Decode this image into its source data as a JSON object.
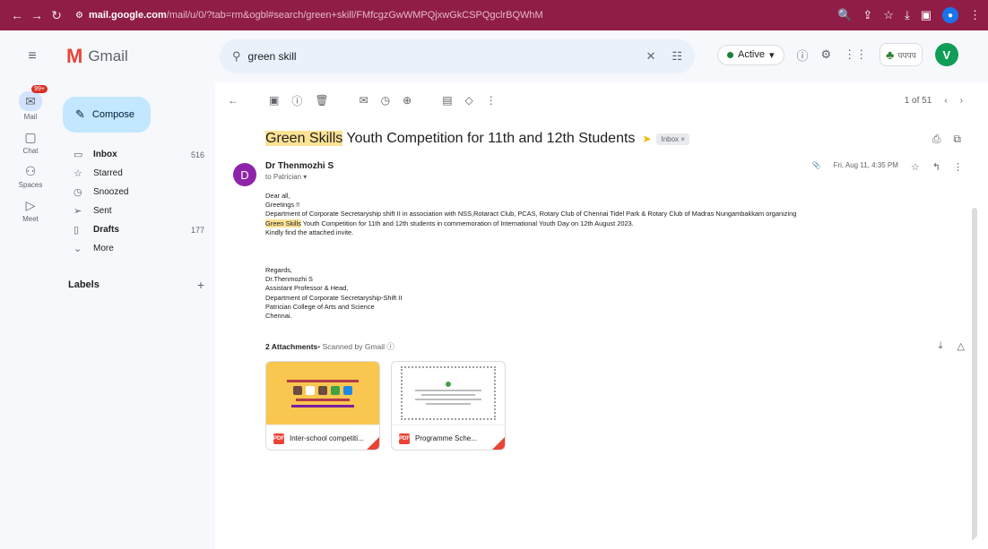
{
  "browser": {
    "url_host": "mail.google.com",
    "url_path": "/mail/u/0/?tab=rm&ogbl#search/green+skill/FMfcgzGwWMPQjxwGkCSPQgclrBQWhM"
  },
  "app": {
    "name": "Gmail"
  },
  "search": {
    "query": "green skill"
  },
  "header": {
    "status": "Active",
    "org_logo_text": "पपपप",
    "avatar_letter": "V"
  },
  "rail": {
    "items": [
      {
        "label": "Mail",
        "badge": "99+"
      },
      {
        "label": "Chat"
      },
      {
        "label": "Spaces"
      },
      {
        "label": "Meet"
      }
    ]
  },
  "sidebar": {
    "compose": "Compose",
    "folders": [
      {
        "label": "Inbox",
        "count": "516",
        "bold": true
      },
      {
        "label": "Starred",
        "count": ""
      },
      {
        "label": "Snoozed",
        "count": ""
      },
      {
        "label": "Sent",
        "count": ""
      },
      {
        "label": "Drafts",
        "count": "177",
        "bold": true
      },
      {
        "label": "More",
        "count": ""
      }
    ],
    "labels_title": "Labels"
  },
  "toolbar": {
    "pager": "1 of 51"
  },
  "email": {
    "subject_hl": "Green Skills",
    "subject_rest": " Youth Competition for 11th and 12th Students",
    "label_chip": "Inbox ×",
    "sender_initial": "D",
    "sender_name": "Dr Thenmozhi S",
    "to": "to Patrician ▾",
    "date": "Fri, Aug 11, 4:35 PM",
    "body": {
      "l1": "Dear all,",
      "l2": "Greetings !!",
      "l3": "Department of Corporate Secretaryship shift II in association with NSS,Rotaract Club, PCAS, Rotary Club of Chennai Tidel Park & Rotary Club of Madras Nungambakkam organizing",
      "l4_hl": "Green Skills",
      "l4_rest": " Youth Competition for 11th and 12th students in commemoration of International Youth Day on 12th August 2023.",
      "l5": "Kindly find the attached invite."
    },
    "signature": {
      "s1": "Regards,",
      "s2": "Dr.Thenmozhi S",
      "s3": "Assistant Professor & Head,",
      "s4": "Department of Corporate Secretaryship-Shift II",
      "s5": "Patrician College of Arts and Science",
      "s6": "Chennai."
    },
    "attachments_title": "2 Attachments",
    "attachments_scan": " • Scanned by Gmail ⓘ",
    "attachments": [
      {
        "name": "Inter-school competiti..."
      },
      {
        "name": "Programme Sche..."
      }
    ]
  }
}
